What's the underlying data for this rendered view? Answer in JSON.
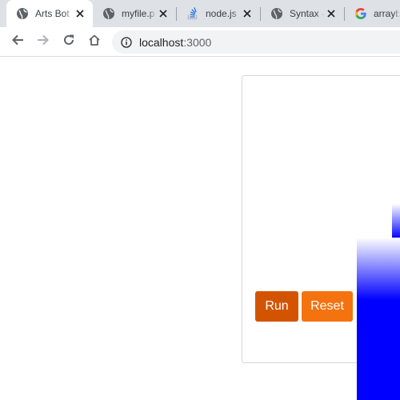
{
  "browser": {
    "tabs": [
      {
        "title": "Arts Bot",
        "icon": "globe-icon",
        "active": true,
        "close_glyph": "✕"
      },
      {
        "title": "myfile.p",
        "icon": "globe-icon",
        "active": false,
        "close_glyph": "✕"
      },
      {
        "title": "node.js",
        "icon": "stackoverflow-icon",
        "active": false,
        "close_glyph": "✕"
      },
      {
        "title": "Syntax -",
        "icon": "globe-icon",
        "active": false,
        "close_glyph": "✕"
      },
      {
        "title": "arrayb",
        "icon": "google-icon",
        "active": false
      }
    ],
    "toolbar": {
      "back_icon": "back-arrow-icon",
      "forward_icon": "forward-arrow-icon",
      "reload_icon": "reload-icon",
      "home_icon": "home-icon"
    },
    "address_bar": {
      "icon": "info-icon",
      "host": "localhost",
      "port": ":3000"
    }
  },
  "page": {
    "controls": {
      "run_label": "Run",
      "reset_label": "Reset"
    },
    "colors": {
      "run_button": "#d35400",
      "reset_button": "#f5730f",
      "art_color": "#0000ff"
    }
  }
}
